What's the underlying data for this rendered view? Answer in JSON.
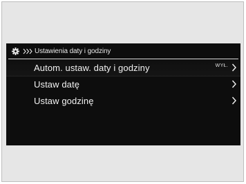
{
  "header": {
    "title": "Ustawienia daty i godziny",
    "icon": "gear-icon"
  },
  "menu": {
    "items": [
      {
        "label": "Autom. ustaw. daty i godziny",
        "status": "WYŁ."
      },
      {
        "label": "Ustaw datę"
      },
      {
        "label": "Ustaw godzinę"
      }
    ]
  },
  "colors": {
    "screen_background": "#0d0d0d",
    "text": "#f2f2f2",
    "frame_background": "#e6e6e6"
  }
}
